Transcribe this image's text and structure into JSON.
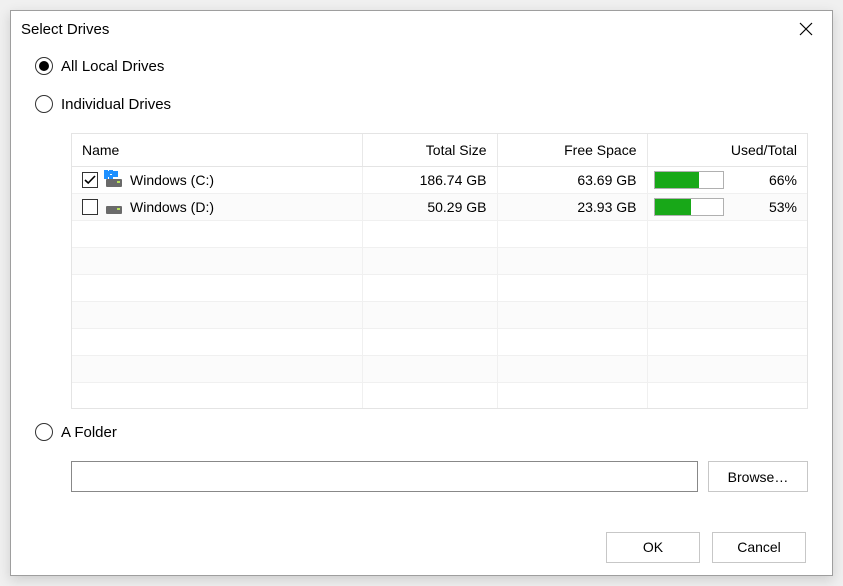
{
  "title": "Select Drives",
  "options": {
    "all_local": "All Local Drives",
    "individual": "Individual Drives",
    "a_folder": "A Folder",
    "selected": "all_local"
  },
  "columns": {
    "name": "Name",
    "total": "Total Size",
    "free": "Free Space",
    "used": "Used/Total"
  },
  "drives": [
    {
      "checked": true,
      "is_os": true,
      "label": "Windows (C:)",
      "total": "186.74 GB",
      "free": "63.69 GB",
      "used_pct": 66,
      "used_pct_label": "66%"
    },
    {
      "checked": false,
      "is_os": false,
      "label": "Windows (D:)",
      "total": "50.29 GB",
      "free": "23.93 GB",
      "used_pct": 53,
      "used_pct_label": "53%"
    }
  ],
  "folder_path": "",
  "buttons": {
    "browse": "Browse…",
    "ok": "OK",
    "cancel": "Cancel"
  },
  "colors": {
    "bar_fill": "#18a818"
  }
}
